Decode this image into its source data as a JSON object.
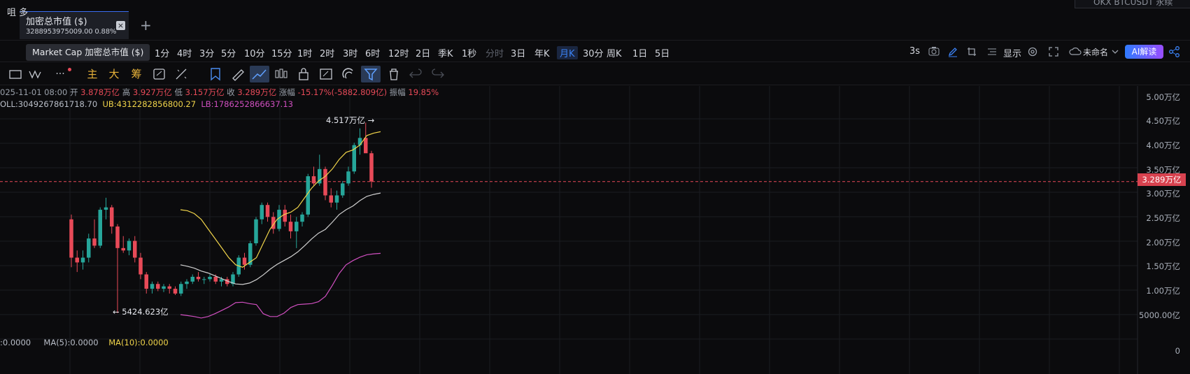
{
  "tab": {
    "title": "加密总市值 ($)",
    "sub": "3288953975009.00  0.88%",
    "close": "×",
    "add": "+"
  },
  "top_right": {
    "text": "OKX BTCUSDT 永续"
  },
  "symbol_fragment": "咀 多",
  "tooltip": "Market Cap 加密总市值 ($)",
  "intervals": [
    {
      "label": "1分",
      "state": "normal"
    },
    {
      "label": "4时",
      "state": "normal"
    },
    {
      "label": "3分",
      "state": "normal"
    },
    {
      "label": "5分",
      "state": "normal"
    },
    {
      "label": "10分",
      "state": "normal"
    },
    {
      "label": "15分",
      "state": "normal"
    },
    {
      "label": "1时",
      "state": "normal"
    },
    {
      "label": "2时",
      "state": "normal"
    },
    {
      "label": "3时",
      "state": "normal"
    },
    {
      "label": "6时",
      "state": "normal"
    },
    {
      "label": "12时",
      "state": "normal"
    },
    {
      "label": "2日",
      "state": "normal"
    },
    {
      "label": "季K",
      "state": "normal"
    },
    {
      "label": "1秒",
      "state": "normal"
    },
    {
      "label": "分时",
      "state": "dim"
    },
    {
      "label": "3日",
      "state": "normal"
    },
    {
      "label": "年K",
      "state": "normal"
    },
    {
      "label": "月K",
      "state": "active"
    },
    {
      "label": "30分",
      "state": "normal"
    },
    {
      "label": "周K",
      "state": "normal"
    },
    {
      "label": "1日",
      "state": "normal"
    },
    {
      "label": "5日",
      "state": "normal"
    }
  ],
  "toolbar_right": {
    "refresh": "3s",
    "display": "显示",
    "unnamed": "未命名",
    "ai": "AI解读"
  },
  "draw_tools": {
    "main": "主",
    "big": "大",
    "chips": "筹",
    "more": "···"
  },
  "ohlc": {
    "date": "025-11-01 08:00",
    "open_label": "开",
    "open": "3.878万亿",
    "high_label": "高",
    "high": "3.927万亿",
    "low_label": "低",
    "low": "3.157万亿",
    "close_label": "收",
    "close": "3.289万亿",
    "chg_label": "涨幅",
    "chg": "-15.17%(-5882.809亿)",
    "amp_label": "振幅",
    "amp": "19.85%"
  },
  "boll": {
    "mid": "OLL:3049267861718.70",
    "ub": "UB:4312282856800.27",
    "lb": "LB:1786252866637.13"
  },
  "volume": {
    "vol": ":0.0000",
    "ma5": "MA(5):0.0000",
    "ma10": "MA(10):0.0000"
  },
  "annotations": {
    "high": "4.517万亿 →",
    "low": "← 5424.623亿"
  },
  "current_price_tag": "3.289万亿",
  "colors": {
    "up": "#26a69a",
    "down": "#e84a58",
    "boll_ub": "#f0d44a",
    "boll_mid": "#d0d0d0",
    "boll_lb": "#d04fc0",
    "bg": "#0b0b0d",
    "accent": "#3b82f6"
  },
  "chart_data": {
    "type": "candlestick",
    "unit": "万亿",
    "y_axis_ticks": [
      "5.00万亿",
      "4.50万亿",
      "4.00万亿",
      "3.50万亿",
      "3.00万亿",
      "2.50万亿",
      "2.00万亿",
      "1.50万亿",
      "1.00万亿",
      "5000.00亿"
    ],
    "volume_axis_tick": "0",
    "ylim": [
      0.4,
      5.2
    ],
    "current_price": 3.289,
    "candles": [
      [
        2.5,
        2.6,
        1.5,
        1.7
      ],
      [
        1.7,
        1.85,
        1.4,
        1.6
      ],
      [
        1.6,
        1.85,
        1.45,
        1.7
      ],
      [
        1.7,
        2.2,
        1.6,
        2.1
      ],
      [
        2.1,
        2.5,
        1.9,
        1.95
      ],
      [
        1.95,
        2.75,
        1.9,
        2.7
      ],
      [
        2.7,
        2.95,
        2.5,
        2.75
      ],
      [
        2.75,
        2.8,
        2.2,
        2.35
      ],
      [
        2.35,
        2.4,
        0.54,
        1.9
      ],
      [
        1.9,
        2.15,
        1.8,
        1.85
      ],
      [
        1.85,
        2.1,
        1.75,
        2.05
      ],
      [
        2.05,
        2.15,
        1.6,
        1.7
      ],
      [
        1.7,
        1.8,
        1.25,
        1.35
      ],
      [
        1.35,
        1.4,
        0.95,
        1.05
      ],
      [
        1.05,
        1.2,
        0.95,
        1.15
      ],
      [
        1.15,
        1.2,
        1.0,
        1.05
      ],
      [
        1.05,
        1.15,
        0.98,
        1.1
      ],
      [
        1.1,
        1.15,
        0.95,
        1.05
      ],
      [
        1.05,
        1.1,
        0.92,
        0.95
      ],
      [
        0.95,
        1.2,
        0.9,
        1.15
      ],
      [
        1.15,
        1.25,
        1.05,
        1.2
      ],
      [
        1.2,
        1.35,
        1.15,
        1.3
      ],
      [
        1.3,
        1.4,
        1.2,
        1.25
      ],
      [
        1.25,
        1.3,
        1.15,
        1.25
      ],
      [
        1.25,
        1.35,
        1.2,
        1.3
      ],
      [
        1.3,
        1.35,
        1.15,
        1.2
      ],
      [
        1.2,
        1.3,
        1.1,
        1.25
      ],
      [
        1.25,
        1.3,
        1.1,
        1.15
      ],
      [
        1.15,
        1.4,
        1.1,
        1.35
      ],
      [
        1.35,
        1.75,
        1.3,
        1.7
      ],
      [
        1.7,
        1.8,
        1.45,
        1.55
      ],
      [
        1.55,
        2.05,
        1.5,
        2.0
      ],
      [
        2.0,
        2.55,
        1.95,
        2.5
      ],
      [
        2.5,
        2.85,
        2.4,
        2.8
      ],
      [
        2.8,
        2.85,
        2.45,
        2.55
      ],
      [
        2.55,
        2.65,
        2.2,
        2.3
      ],
      [
        2.3,
        2.8,
        2.25,
        2.7
      ],
      [
        2.7,
        2.8,
        2.35,
        2.45
      ],
      [
        2.45,
        2.6,
        2.1,
        2.25
      ],
      [
        2.25,
        2.55,
        1.9,
        2.45
      ],
      [
        2.45,
        2.65,
        2.35,
        2.6
      ],
      [
        2.6,
        3.45,
        2.55,
        3.4
      ],
      [
        3.4,
        3.6,
        3.2,
        3.25
      ],
      [
        3.25,
        3.85,
        3.2,
        3.55
      ],
      [
        3.55,
        3.6,
        2.9,
        3.0
      ],
      [
        3.0,
        3.15,
        2.75,
        2.85
      ],
      [
        2.85,
        3.1,
        2.7,
        3.0
      ],
      [
        3.0,
        3.3,
        2.95,
        3.25
      ],
      [
        3.25,
        3.6,
        3.2,
        3.5
      ],
      [
        3.5,
        4.1,
        3.45,
        4.05
      ],
      [
        4.05,
        4.4,
        3.85,
        4.2
      ],
      [
        4.2,
        4.52,
        3.95,
        3.88
      ],
      [
        3.88,
        3.93,
        3.16,
        3.29
      ]
    ],
    "boll_upper": [
      2.7,
      2.68,
      2.62,
      2.5,
      2.3,
      2.1,
      1.9,
      1.7,
      1.55,
      1.5,
      1.6,
      1.7,
      2.0,
      2.3,
      2.5,
      2.6,
      2.65,
      2.75,
      2.95,
      3.15,
      3.3,
      3.4,
      3.55,
      3.75,
      3.9,
      3.95,
      4.05,
      4.25,
      4.3,
      4.33
    ],
    "boll_mid": [
      1.55,
      1.52,
      1.48,
      1.42,
      1.38,
      1.32,
      1.26,
      1.2,
      1.15,
      1.14,
      1.17,
      1.24,
      1.34,
      1.46,
      1.56,
      1.64,
      1.72,
      1.82,
      1.95,
      2.09,
      2.21,
      2.29,
      2.44,
      2.6,
      2.7,
      2.78,
      2.89,
      2.98,
      3.02,
      3.05
    ],
    "boll_lower": [
      0.51,
      0.49,
      0.47,
      0.44,
      0.47,
      0.53,
      0.6,
      0.67,
      0.76,
      0.77,
      0.74,
      0.72,
      0.53,
      0.47,
      0.47,
      0.54,
      0.66,
      0.72,
      0.73,
      0.74,
      0.78,
      0.89,
      1.12,
      1.37,
      1.55,
      1.64,
      1.71,
      1.76,
      1.78,
      1.79
    ]
  }
}
